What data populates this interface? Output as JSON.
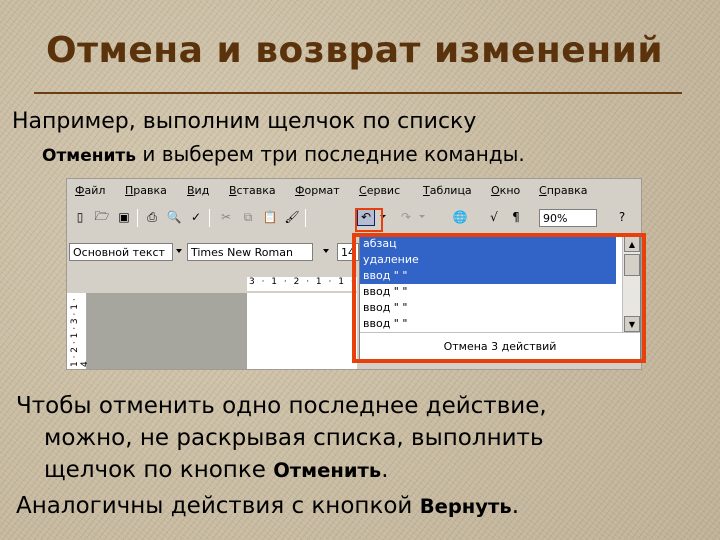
{
  "slide": {
    "title": "Отмена и возврат изменений",
    "para1_line1": "Например, выполним щелчок по списку",
    "para1_bold": "Отменить",
    "para1_line2_rest": " и выберем три последние команды.",
    "para2_line1": "Чтобы отменить одно последнее действие,",
    "para2_line2": "можно, не раскрывая списка, выполнить",
    "para2_line3_prefix": "щелчок по кнопке ",
    "para2_bold": "Отменить",
    "para2_end": ".",
    "para3_prefix": "Аналогичны действия с кнопкой ",
    "para3_bold": "Вернуть",
    "para3_end": "."
  },
  "word": {
    "menu": [
      "Файл",
      "Правка",
      "Вид",
      "Вставка",
      "Формат",
      "Сервис",
      "Таблица",
      "Окно",
      "Справка"
    ],
    "zoom": "90%",
    "style_combo": "Основной текст",
    "font_combo": "Times New Roman",
    "size_combo": "14",
    "ruler": "3 · 1 · 2 · 1 · 1 ·",
    "vruler": "1 · 2 · 1 · 3 · 1 · 4",
    "undo_list": [
      "абзац",
      "удаление",
      "ввод \" \"",
      "ввод \" \"",
      "ввод \" \"",
      "ввод \" \""
    ],
    "undo_selected_count": 3,
    "undo_footer": "Отмена 3 действий"
  },
  "colors": {
    "title": "#5a320c",
    "highlight": "#e8400c",
    "selection": "#3264c8"
  },
  "icons": [
    "new-doc-icon",
    "open-folder-icon",
    "save-icon",
    "print-icon",
    "print-preview-icon",
    "spelling-icon",
    "cut-icon",
    "copy-icon",
    "paste-icon",
    "format-painter-icon",
    "undo-icon",
    "redo-icon",
    "hyperlink-icon",
    "formula-icon",
    "pilcrow-icon",
    "help-icon"
  ]
}
